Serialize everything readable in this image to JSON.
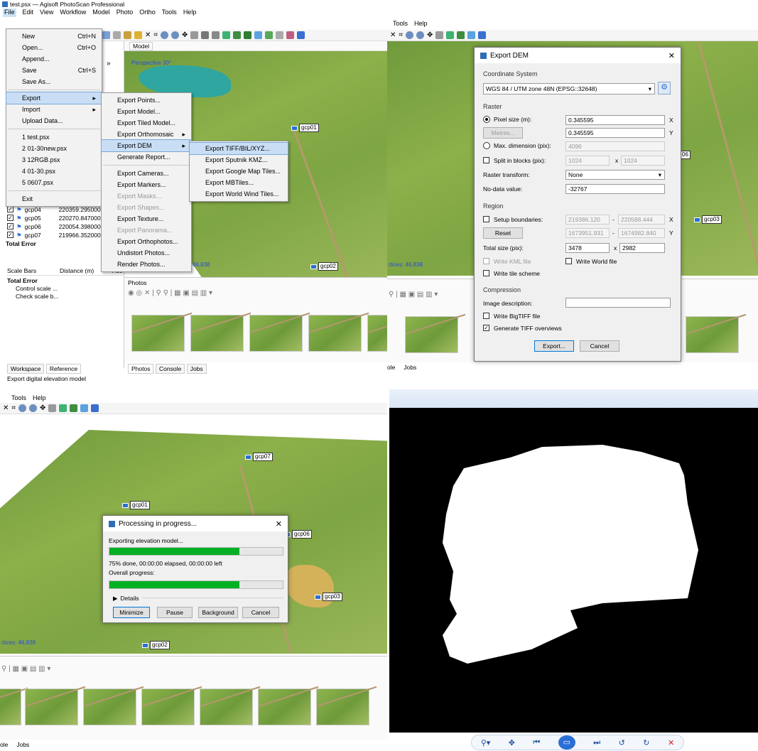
{
  "q1": {
    "title": "test.psx — Agisoft PhotoScan Professional",
    "menubar": [
      "File",
      "Edit",
      "View",
      "Workflow",
      "Model",
      "Photo",
      "Ortho",
      "Tools",
      "Help"
    ],
    "model_tab": "Model",
    "perspective": "Perspective 30°",
    "file_menu": [
      {
        "label": "New",
        "shortcut": "Ctrl+N"
      },
      {
        "label": "Open...",
        "shortcut": "Ctrl+O"
      },
      {
        "label": "Append...",
        "shortcut": ""
      },
      {
        "label": "Save",
        "shortcut": "Ctrl+S"
      },
      {
        "label": "Save As...",
        "shortcut": ""
      },
      {
        "label": "Export",
        "shortcut": "▸"
      },
      {
        "label": "Import",
        "shortcut": "▸"
      },
      {
        "label": "Upload Data...",
        "shortcut": ""
      },
      {
        "label": "1 test.psx",
        "shortcut": ""
      },
      {
        "label": "2 01-30new.psx",
        "shortcut": ""
      },
      {
        "label": "3 12RGB.psx",
        "shortcut": ""
      },
      {
        "label": "4 01-30.psx",
        "shortcut": ""
      },
      {
        "label": "5 0607.psx",
        "shortcut": ""
      },
      {
        "label": "Exit",
        "shortcut": ""
      }
    ],
    "export_menu": [
      "Export Points...",
      "Export Model...",
      "Export Tiled Model...",
      "Export Orthomosaic",
      "Export DEM",
      "Generate Report...",
      "Export Cameras...",
      "Export Markers...",
      "Export Masks...",
      "Export Shapes...",
      "Export Texture...",
      "Export Panorama...",
      "Export Orthophotos...",
      "Undistort Photos...",
      "Render Photos..."
    ],
    "dem_menu": [
      "Export TIFF/BIL/XYZ...",
      "Export Sputnik KMZ...",
      "Export Google Map Tiles...",
      "Export MBTiles...",
      "Export World Wind Tiles..."
    ],
    "gcp_rows": [
      {
        "name": "gcp04",
        "val": "220359.295000"
      },
      {
        "name": "gcp05",
        "val": "220270.847000"
      },
      {
        "name": "gcp06",
        "val": "220054.398000"
      },
      {
        "name": "gcp07",
        "val": "219966.352000"
      }
    ],
    "total_error": "Total Error",
    "scale_headers": [
      "Scale Bars",
      "Distance (m)",
      "Acc"
    ],
    "scale_items": [
      "Total Error",
      "Control scale ...",
      "Check scale b..."
    ],
    "left_tabs": [
      "Workspace",
      "Reference"
    ],
    "photos_label": "Photos",
    "bottom_tabs": [
      "Photos",
      "Console",
      "Jobs"
    ],
    "status": "Export digital elevation model",
    "vertices": "46,838",
    "gcps": [
      "gcp01",
      "gcp02"
    ],
    "chevron": "»",
    "float_ctrl": "🗗 ✕"
  },
  "q2": {
    "menubar": [
      "Tools",
      "Help"
    ],
    "dialog_title": "Export DEM",
    "coord_header": "Coordinate System",
    "crs": "WGS 84 / UTM zone 48N (EPSG::32648)",
    "raster_header": "Raster",
    "pixel_size_label": "Pixel size (m):",
    "pixel_x": "0.345595",
    "pixel_y": "0.345595",
    "metres_btn": "Metres...",
    "max_dim_label": "Max. dimension (pix):",
    "max_dim": "4096",
    "split_label": "Split in blocks (pix):",
    "split_a": "1024",
    "split_b": "1024",
    "transform_label": "Raster transform:",
    "transform": "None",
    "nodata_label": "No-data value:",
    "nodata": "-32767",
    "region_header": "Region",
    "setup_label": "Setup boundaries:",
    "bx1": "219386.120",
    "bx2": "220588.444",
    "by1": "1673951.931",
    "by2": "1674982.840",
    "reset_btn": "Reset",
    "total_label": "Total size (pix):",
    "total_w": "3478",
    "total_h": "2982",
    "kml_label": "Write KML file",
    "world_label": "Write World file",
    "tile_label": "Write tile scheme",
    "comp_header": "Compression",
    "desc_label": "Image description:",
    "bigtiff_label": "Write BigTIFF file",
    "overview_label": "Generate TIFF overviews",
    "export_btn": "Export...",
    "cancel_btn": "Cancel",
    "x": "X",
    "y": "Y",
    "dash": "-",
    "times": "x",
    "vertices_text": "rtices: 46,838",
    "tabs": [
      "ole",
      "Jobs"
    ],
    "gcps": [
      "06",
      "gcp03"
    ]
  },
  "q3": {
    "menubar": [
      "Tools",
      "Help"
    ],
    "dialog_title": "Processing in progress...",
    "task": "Exporting elevation model...",
    "progress_pct": 75,
    "progress_text": "75% done, 00:00:00 elapsed, 00:00:00 left",
    "overall_label": "Overall progress:",
    "overall_pct": 75,
    "details": "Details",
    "buttons": [
      "Minimize",
      "Pause",
      "Background",
      "Cancel"
    ],
    "gcps": [
      "gcp07",
      "gcp01",
      "gcp06",
      "gcp03",
      "gcp02"
    ],
    "vertices_text": "rtices: 46,838",
    "tabs": [
      "ole",
      "Jobs"
    ]
  },
  "q4": {
    "viewer_controls": [
      "zoom-icon",
      "pan-icon",
      "prev-icon",
      "slideshow-icon",
      "next-icon",
      "rotate-left-icon",
      "rotate-right-icon",
      "delete-icon"
    ]
  }
}
